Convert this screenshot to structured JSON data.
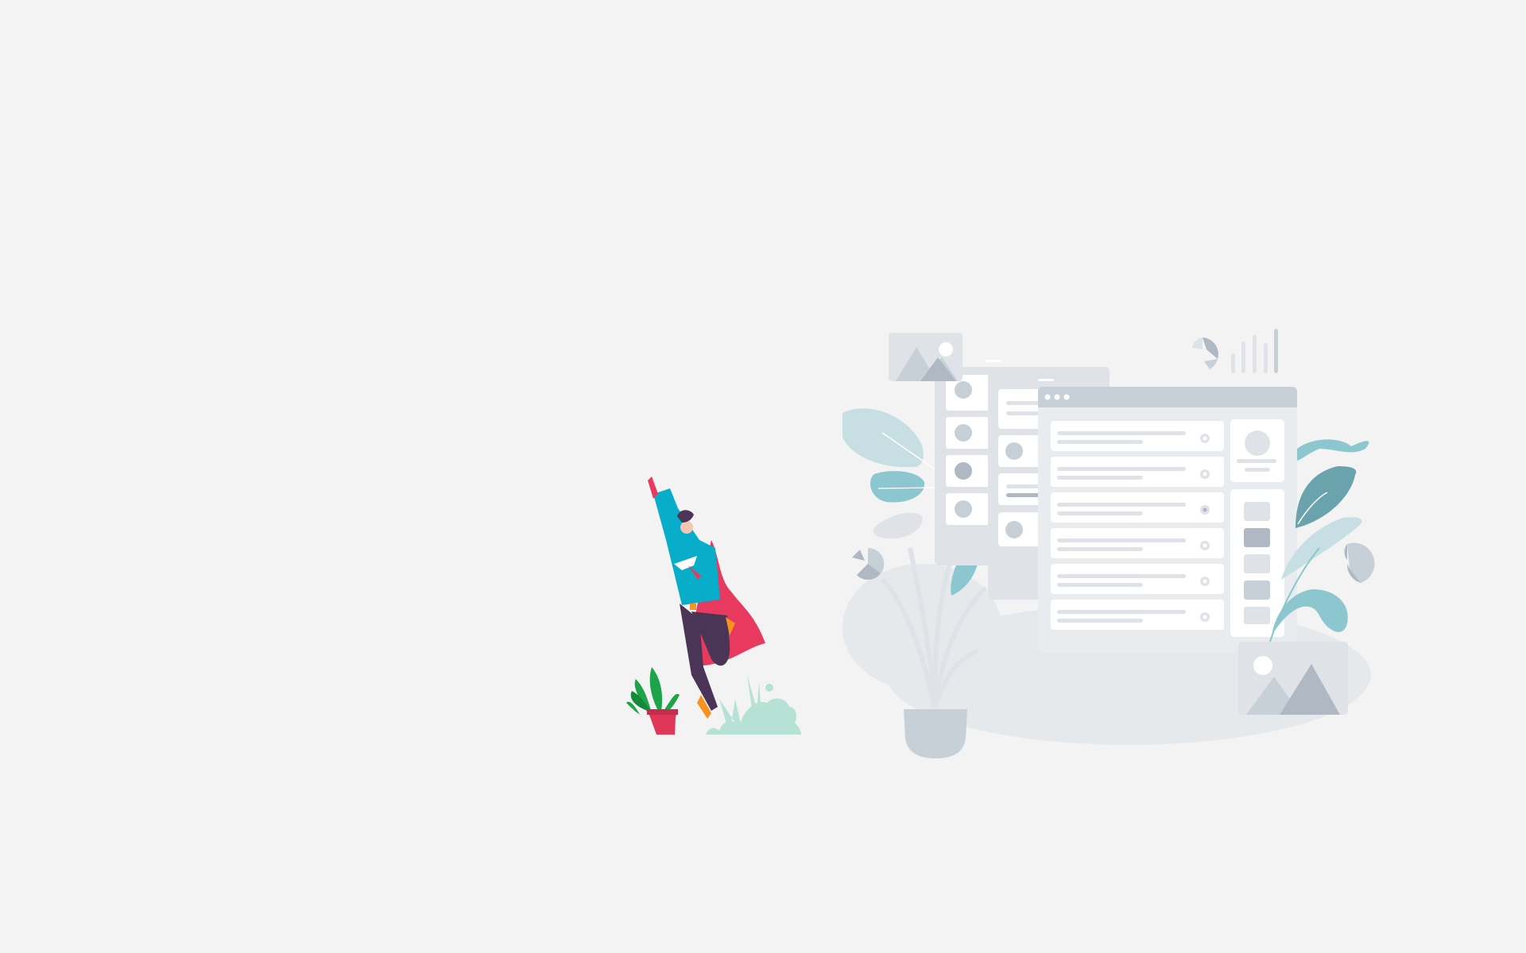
{
  "colors": {
    "background": "#f3f3f3",
    "placeholder_panel": "#dfe3e8",
    "placeholder_header": "#c8d0d7",
    "placeholder_mark": "#b0b8c3",
    "card": "#ffffff",
    "leaf_teal": "#8cc7cf",
    "leaf_pale": "#c7dfe2",
    "leaf_dark": "#6ba3ad",
    "hero_shirt": "#08adc9",
    "hero_cape": "#e83a5f",
    "hero_pants": "#4b3556",
    "plant_green": "#1fa34a",
    "pot_red": "#e03758",
    "bush_mint": "#b5e2d4"
  },
  "illustration": {
    "hero": "superhero-flying",
    "potted_plant": "potted-plant-icon",
    "bush": "bush-icon",
    "windows": "placeholder-app-windows",
    "image_placeholder": "image-placeholder-icon",
    "bar_chart": "bar-chart-icon",
    "pie_chart": "pie-chart-icon"
  }
}
